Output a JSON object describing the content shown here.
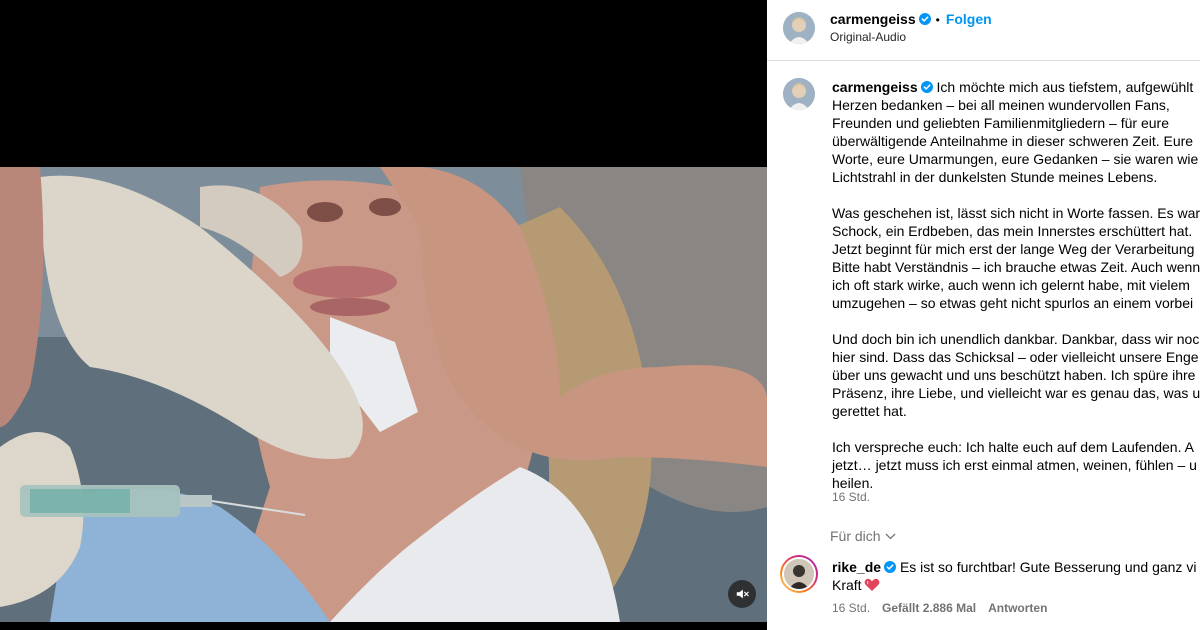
{
  "post": {
    "username": "carmengeiss",
    "follow_label": "Folgen",
    "separator": "•",
    "audio_label": "Original-Audio",
    "caption_username": "carmengeiss",
    "caption_lines": [
      [
        "Ich möchte mich aus tiefstem, aufgewühlt",
        "Herzen bedanken – bei all meinen wundervollen Fans,",
        "Freunden und geliebten Familienmitgliedern – für eure",
        "überwältigende Anteilnahme in dieser schweren Zeit. Eure",
        "Worte, eure Umarmungen, eure Gedanken – sie waren wie",
        "Lichtstrahl in der dunkelsten Stunde meines Lebens."
      ],
      [
        "Was geschehen ist, lässt sich nicht in Worte fassen. Es war",
        "Schock, ein Erdbeben, das mein Innerstes erschüttert hat.",
        "Jetzt beginnt für mich erst der lange Weg der Verarbeitung",
        "Bitte habt Verständnis – ich brauche etwas Zeit. Auch wenn",
        "ich oft stark wirke, auch wenn ich gelernt habe, mit vielem",
        "umzugehen – so etwas geht nicht spurlos an einem vorbei"
      ],
      [
        "Und doch bin ich unendlich dankbar. Dankbar, dass wir noc",
        "hier sind. Dass das Schicksal – oder vielleicht unsere Enge",
        "über uns gewacht und uns beschützt haben. Ich spüre ihre",
        "Präsenz, ihre Liebe, und vielleicht war es genau das, was u",
        "gerettet hat."
      ],
      [
        "Ich verspreche euch: Ich halte euch auf dem Laufenden. A",
        "jetzt… jetzt muss ich erst einmal atmen, weinen, fühlen – u",
        "heilen."
      ]
    ],
    "caption_time": "16 Std."
  },
  "comments_filter": "Für dich",
  "comment": {
    "username": "rike_de",
    "text_line1": "Es ist so furchtbar! Gute Besserung und ganz vi",
    "text_line2": "Kraft",
    "time": "16 Std.",
    "likes": "Gefällt 2.886 Mal",
    "reply_label": "Antworten"
  },
  "icons": {
    "verified": "verified-badge-icon",
    "mute": "speaker-muted-icon",
    "chevron": "chevron-down-icon",
    "heart": "heart-emoji-icon"
  },
  "colors": {
    "accent": "#0095f6",
    "secondary_text": "#737373",
    "divider": "#dbdbdb",
    "video_bg": "#000000"
  }
}
